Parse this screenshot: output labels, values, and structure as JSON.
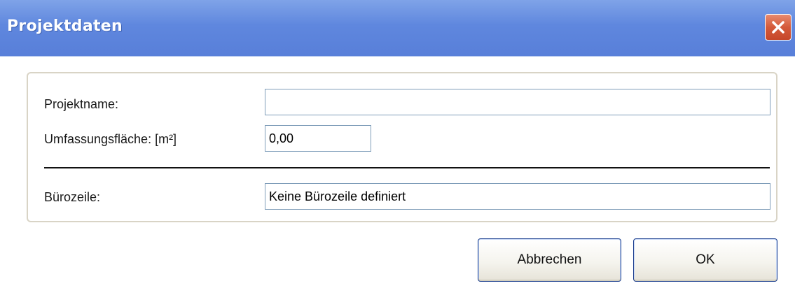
{
  "window": {
    "title": "Projektdaten",
    "close_icon": "close-icon"
  },
  "form": {
    "project_name": {
      "label": "Projektname:",
      "value": ""
    },
    "area": {
      "label": "Umfassungsfläche: [m²]",
      "value": "0,00"
    },
    "office_line": {
      "label": "Bürozeile:",
      "value": "Keine Bürozeile definiert"
    }
  },
  "buttons": {
    "cancel_label": "Abbrechen",
    "ok_label": "OK"
  },
  "colors": {
    "titlebar": "#5f87de",
    "close_button": "#d45a3a",
    "group_border": "#d9d4c6",
    "input_border": "#7f9db9",
    "button_border": "#1c3f8f"
  }
}
